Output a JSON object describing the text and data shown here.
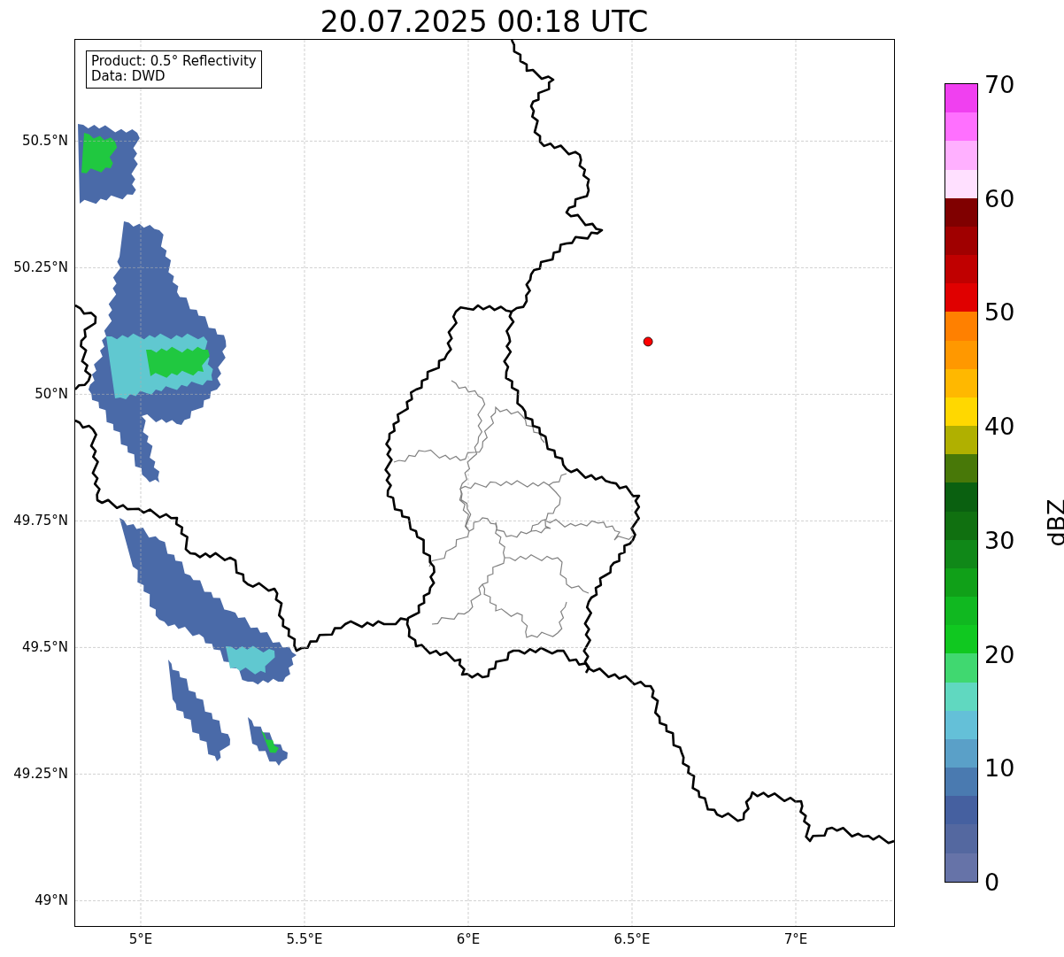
{
  "info_box": [
    "Product: 0.5° Reflectivity",
    "Data: DWD"
  ],
  "chart_data": {
    "type": "scatter",
    "title": "20.07.2025 00:18 UTC",
    "grid": true,
    "xlim": [
      4.8,
      7.3
    ],
    "ylim": [
      48.95,
      50.7
    ],
    "xticks": [
      {
        "value": 5,
        "label": "5°E"
      },
      {
        "value": 5.5,
        "label": "5.5°E"
      },
      {
        "value": 6,
        "label": "6°E"
      },
      {
        "value": 6.5,
        "label": "6.5°E"
      },
      {
        "value": 7,
        "label": "7°E"
      }
    ],
    "yticks": [
      {
        "value": 50.5,
        "label": "50.5°N"
      },
      {
        "value": 50.25,
        "label": "50.25°N"
      },
      {
        "value": 50,
        "label": "50°N"
      },
      {
        "value": 49.75,
        "label": "49.75°N"
      },
      {
        "value": 49.5,
        "label": "49.5°N"
      },
      {
        "value": 49.25,
        "label": "49.25°N"
      },
      {
        "value": 49,
        "label": "49°N"
      }
    ],
    "x": [
      6.549
    ],
    "series": [
      {
        "color": "#ff0000",
        "values": [
          50.104
        ]
      }
    ]
  },
  "colorbar": {
    "label": "dBZ",
    "ticks": [
      "70",
      "60",
      "50",
      "40",
      "30",
      "20",
      "10",
      "0"
    ],
    "levels": [
      {
        "color": "#f040f0"
      },
      {
        "color": "#ff70ff"
      },
      {
        "color": "#ffb0ff"
      },
      {
        "color": "#ffe0ff"
      },
      {
        "color": "#800000"
      },
      {
        "color": "#a00000"
      },
      {
        "color": "#c00000"
      },
      {
        "color": "#e00000"
      },
      {
        "color": "#ff8000"
      },
      {
        "color": "#ff9800"
      },
      {
        "color": "#ffb800"
      },
      {
        "color": "#ffd800"
      },
      {
        "color": "#b0b000"
      },
      {
        "color": "#487808"
      },
      {
        "color": "#0a6010"
      },
      {
        "color": "#107010"
      },
      {
        "color": "#108818"
      },
      {
        "color": "#10a018"
      },
      {
        "color": "#10b820"
      },
      {
        "color": "#10c820"
      },
      {
        "color": "#40d870"
      },
      {
        "color": "#60d8c0"
      },
      {
        "color": "#64c0d8"
      },
      {
        "color": "#5aa0c8"
      },
      {
        "color": "#4a7ab0"
      },
      {
        "color": "#4560a0"
      },
      {
        "color": "#5468a0"
      },
      {
        "color": "#6673a8"
      }
    ]
  }
}
